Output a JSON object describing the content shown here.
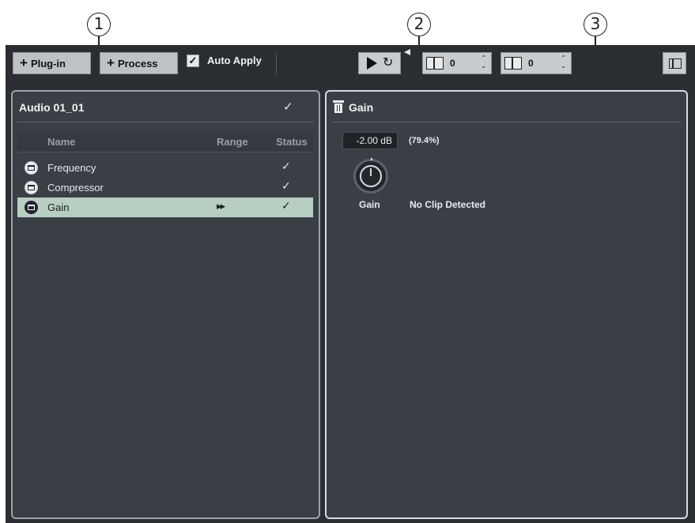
{
  "callouts": [
    "1",
    "2",
    "3"
  ],
  "toolbar": {
    "plugin_label": "Plug-in",
    "process_label": "Process",
    "auto_apply_label": "Auto Apply",
    "auto_apply_checked": true,
    "spin1_value": "0",
    "spin2_value": "0"
  },
  "left_panel": {
    "title": "Audio 01_01",
    "columns": [
      "Name",
      "Range",
      "Status"
    ],
    "rows": [
      {
        "name": "Frequency",
        "status": "✓",
        "range": ""
      },
      {
        "name": "Compressor",
        "status": "✓",
        "range": ""
      },
      {
        "name": "Gain",
        "status": "✓",
        "range": "▸▸",
        "selected": true
      }
    ]
  },
  "right_panel": {
    "title": "Gain",
    "db_value": "-2.00 dB",
    "percent": "(79.4%)",
    "knob_label": "Gain",
    "clip_status": "No Clip Detected"
  },
  "icons": {
    "plus": "+",
    "check": "✓",
    "loop": "↻",
    "spin_arrows": "⌃⌄"
  },
  "colors": {
    "window_bg": "#2b2f33",
    "panel_bg": "#3a3f45",
    "selected_row": "#b7cfc2"
  }
}
